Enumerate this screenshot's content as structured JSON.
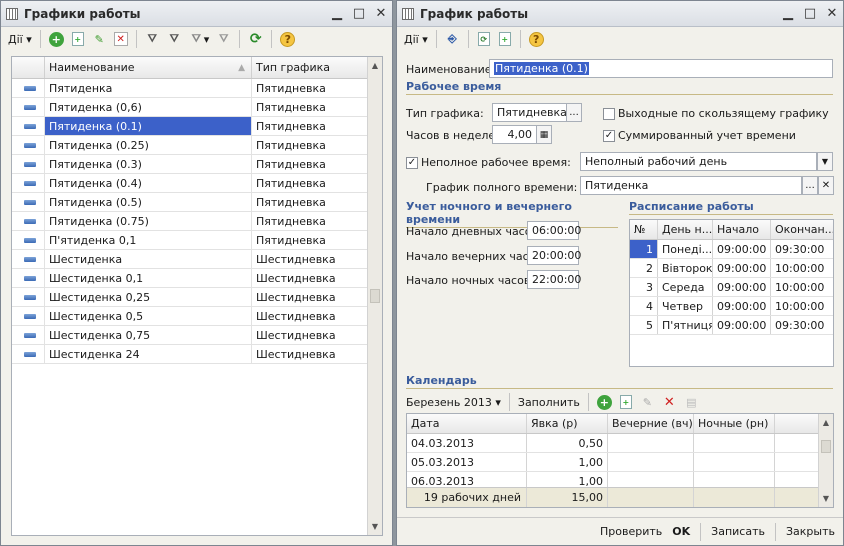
{
  "left": {
    "title": "Графики работы",
    "actions": "Дії",
    "columns": [
      "Наименование",
      "Тип графика"
    ],
    "rows": [
      {
        "name": "Пятиденка",
        "type": "Пятидневка"
      },
      {
        "name": "Пятиденка (0,6)",
        "type": "Пятидневка"
      },
      {
        "name": "Пятиденка (0.1)",
        "type": "Пятидневка"
      },
      {
        "name": "Пятиденка (0.25)",
        "type": "Пятидневка"
      },
      {
        "name": "Пятиденка (0.3)",
        "type": "Пятидневка"
      },
      {
        "name": "Пятиденка (0.4)",
        "type": "Пятидневка"
      },
      {
        "name": "Пятиденка (0.5)",
        "type": "Пятидневка"
      },
      {
        "name": "Пятиденка (0.75)",
        "type": "Пятидневка"
      },
      {
        "name": "П'ятиденка 0,1",
        "type": "Пятидневка"
      },
      {
        "name": "Шестиденка",
        "type": "Шестидневка"
      },
      {
        "name": "Шестиденка 0,1",
        "type": "Шестидневка"
      },
      {
        "name": "Шестиденка 0,25",
        "type": "Шестидневка"
      },
      {
        "name": "Шестиденка 0,5",
        "type": "Шестидневка"
      },
      {
        "name": "Шестиденка 0,75",
        "type": "Шестидневка"
      },
      {
        "name": "Шестиденка 24",
        "type": "Шестидневка"
      }
    ],
    "selected_row": 2
  },
  "right": {
    "title": "График работы",
    "actions": "Дії",
    "name_label": "Наименование:",
    "name_value": "Пятиденка (0.1)",
    "work_time_section": "Рабочее время",
    "type_label": "Тип графика:",
    "type_value": "Пятидневка",
    "sliding_label": "Выходные по скользящему графику",
    "sliding_checked": false,
    "hours_label": "Часов в неделе:",
    "hours_value": "4,00",
    "summ_label": "Суммированный учет времени",
    "summ_checked": true,
    "partial_label": "Неполное рабочее время:",
    "partial_checked": true,
    "partial_value": "Неполный рабочий день",
    "fulltime_label": "График полного времени:",
    "fulltime_value": "Пятиденка",
    "night_section": "Учет ночного и вечернего времени",
    "day_start_label": "Начало дневных часов:",
    "day_start_value": "06:00:00",
    "evening_start_label": "Начало вечерних часов:",
    "evening_start_value": "20:00:00",
    "night_start_label": "Начало ночных часов:",
    "night_start_value": "22:00:00",
    "schedule_section": "Расписание работы",
    "schedule_columns": [
      "№",
      "День н...",
      "Начало",
      "Окончан..."
    ],
    "schedule_rows": [
      {
        "n": "1",
        "day": "Понеді...",
        "start": "09:00:00",
        "end": "09:30:00"
      },
      {
        "n": "2",
        "day": "Вівторок",
        "start": "09:00:00",
        "end": "10:00:00"
      },
      {
        "n": "3",
        "day": "Середа",
        "start": "09:00:00",
        "end": "10:00:00"
      },
      {
        "n": "4",
        "day": "Четвер",
        "start": "09:00:00",
        "end": "10:00:00"
      },
      {
        "n": "5",
        "day": "П'ятниця",
        "start": "09:00:00",
        "end": "09:30:00"
      }
    ],
    "calendar_section": "Календарь",
    "month": "Березень 2013",
    "fill_label": "Заполнить",
    "calendar_columns": [
      "Дата",
      "Явка (р)",
      "Вечерние (вч)",
      "Ночные (рн)"
    ],
    "calendar_rows": [
      {
        "date": "04.03.2013",
        "presence": "0,50",
        "evening": "",
        "night": ""
      },
      {
        "date": "05.03.2013",
        "presence": "1,00",
        "evening": "",
        "night": ""
      },
      {
        "date": "06.03.2013",
        "presence": "1,00",
        "evening": "",
        "night": ""
      }
    ],
    "footer_days": "19 рабочих дней",
    "footer_total": "15,00",
    "buttons": {
      "check": "Проверить",
      "ok": "OK",
      "save": "Записать",
      "close": "Закрыть"
    }
  }
}
